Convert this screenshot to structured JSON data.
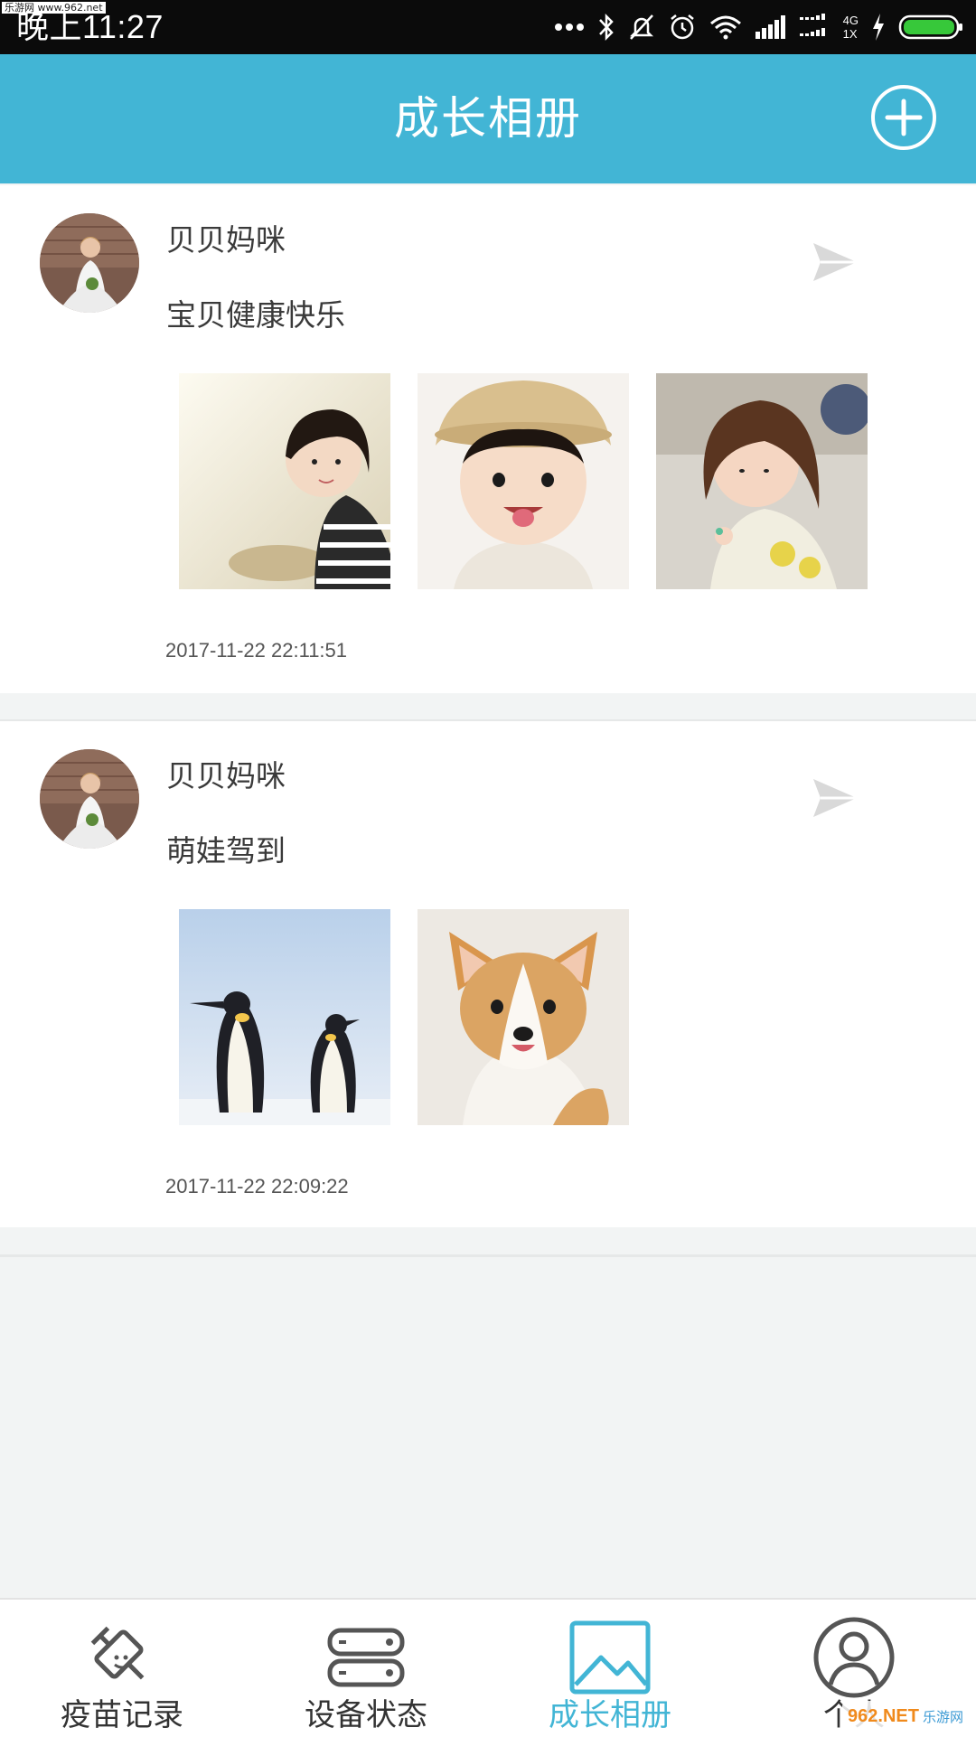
{
  "status_bar": {
    "time": "晚上11:27",
    "network_label": "4G",
    "sim_label": "1X",
    "watermark": "乐游网 www.962.net"
  },
  "header": {
    "title": "成长相册"
  },
  "posts": [
    {
      "user_name": "贝贝妈咪",
      "text": "宝贝健康快乐",
      "timestamp": "2017-11-22 22:11:51",
      "photos": [
        "child-photo-1",
        "child-photo-2",
        "child-photo-3"
      ]
    },
    {
      "user_name": "贝贝妈咪",
      "text": "萌娃驾到",
      "timestamp": "2017-11-22 22:09:22",
      "photos": [
        "penguin-photo",
        "puppy-photo"
      ]
    }
  ],
  "bottom_nav": {
    "items": [
      {
        "label": "疫苗记录",
        "icon": "syringe-icon"
      },
      {
        "label": "设备状态",
        "icon": "device-icon"
      },
      {
        "label": "成长相册",
        "icon": "image-icon",
        "active": true
      },
      {
        "label": "个人",
        "icon": "person-icon"
      }
    ]
  },
  "watermark_bottom": {
    "main": "962.NET",
    "sub": "乐游网"
  },
  "colors": {
    "accent": "#42b5d5",
    "status_bar": "#0b0b0b",
    "background": "#f2f4f4"
  }
}
